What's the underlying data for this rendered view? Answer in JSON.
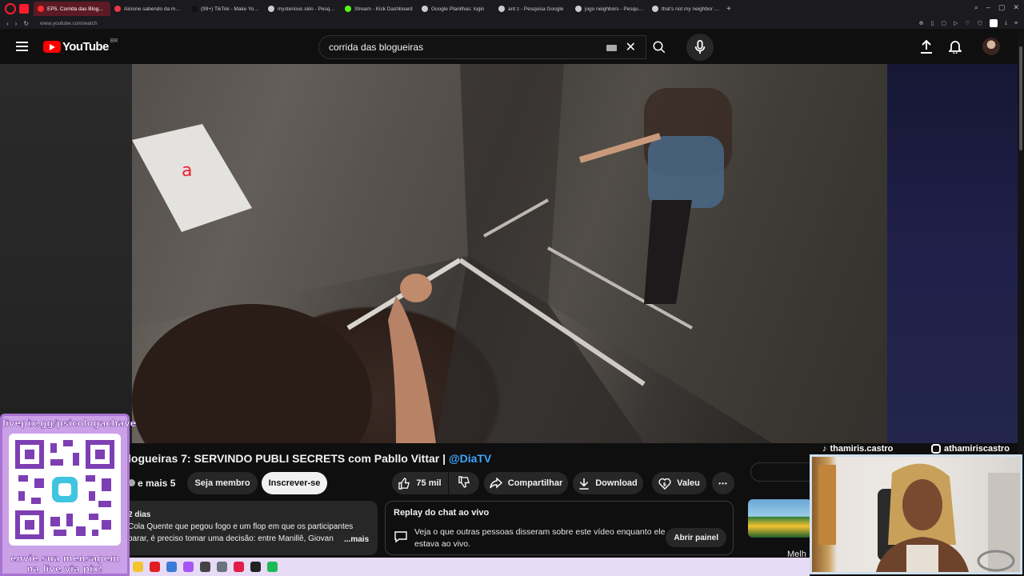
{
  "browser": {
    "tabs": [
      {
        "label": "EP5. Corrida das Blog...",
        "active": true,
        "favicon_color": "#ff2b2b"
      },
      {
        "label": "Alcione sabendo da mort...",
        "active": false,
        "favicon_color": "#e63946"
      },
      {
        "label": "(99+) TikTok - Make Your...",
        "active": false,
        "favicon_color": "#111111"
      },
      {
        "label": "mysterious skin - Pesquis...",
        "active": false,
        "favicon_color": "#cccccc"
      },
      {
        "label": "Stream - Kick Dashboard",
        "active": false,
        "favicon_color": "#53fc18"
      },
      {
        "label": "Google Planilhas: login",
        "active": false,
        "favicon_color": "#cccccc"
      },
      {
        "label": "ant z - Pesquisa Google",
        "active": false,
        "favicon_color": "#cccccc"
      },
      {
        "label": "jogo neighbors - Pesquis...",
        "active": false,
        "favicon_color": "#cccccc"
      },
      {
        "label": "that's not my neighbor - P...",
        "active": false,
        "favicon_color": "#cccccc"
      }
    ],
    "new_tab": "+",
    "url": "www.youtube.com/watch"
  },
  "header": {
    "logo_text": "YouTube",
    "country_code": "BR",
    "search_value": "corrida das blogueiras"
  },
  "video": {
    "title": "logueiras 7: SERVINDO PUBLI SECRETS com Pabllo Vittar | ",
    "title_mention": "@DiaTV"
  },
  "actions": {
    "collab_label": "e mais 5",
    "join_label": "Seja membro",
    "subscribe_label": "Inscrever-se",
    "likes_label": "75 mil",
    "share_label": "Compartilhar",
    "download_label": "Download",
    "thanks_label": "Valeu",
    "more_label": "•••"
  },
  "description": {
    "age": "2 dias",
    "text": "Cola Quente que pegou fogo e um flop em que os participantes parar, é preciso tomar uma decisão: entre Manillê, Giovan",
    "more": "...mais"
  },
  "chat_replay": {
    "header": "Replay do chat ao vivo",
    "text": "Veja o que outras pessoas disseram sobre este vídeo enquanto ele estava ao vivo.",
    "button": "Abrir painel"
  },
  "sidebar": {
    "next_title_fragment": "Melh"
  },
  "overlay": {
    "pix_link": "livepix.gg/psicologachave",
    "pix_message": "envie sua mensagem na live via pix!",
    "tiktok_handle": "thamiris.castro",
    "instagram_handle": "athamiriscastro"
  },
  "taskbar": {
    "icons": [
      "folder-icon",
      "opera-icon",
      "store-icon",
      "opera-gx-icon",
      "media-icon",
      "settings-icon",
      "capcut-icon",
      "obs-icon",
      "spotify-icon"
    ],
    "colors": [
      "#f4c430",
      "#e02020",
      "#3a7bd5",
      "#a855f7",
      "#444444",
      "#6b7280",
      "#e11d48",
      "#222222",
      "#1db954"
    ]
  },
  "colors": {
    "youtube_red": "#ff0000",
    "link_blue": "#3ea6ff",
    "pix_purple": "#caa0e6"
  }
}
